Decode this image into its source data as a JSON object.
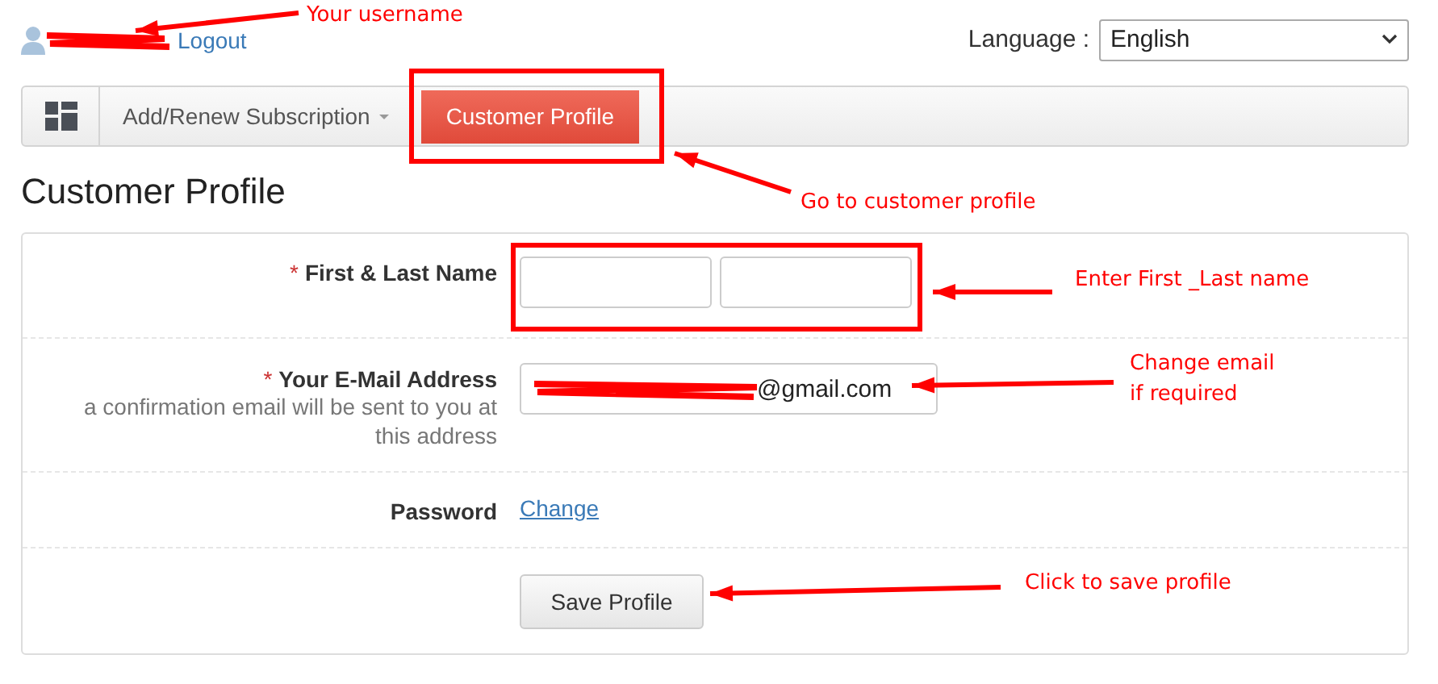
{
  "user_bar": {
    "logout": "Logout",
    "language_label": "Language :",
    "language": "English"
  },
  "nav": {
    "items": [
      {
        "label": "Add/Renew Subscription",
        "kind": "dropdown",
        "selected": false
      },
      {
        "label": "Customer Profile",
        "kind": "button",
        "selected": true
      }
    ]
  },
  "heading": "Customer Profile",
  "form": {
    "rows": [
      {
        "kind": "name",
        "label": "First & Last Name",
        "required_mark": "*"
      },
      {
        "kind": "email",
        "label": "Your E-Mail Address",
        "required_mark": "*",
        "hint": "a confirmation email will be sent to you at this address",
        "value": "@gmail.com"
      },
      {
        "kind": "link",
        "label": "Password",
        "link": "Change"
      },
      {
        "kind": "submit",
        "button": "Save Profile"
      }
    ]
  },
  "annotations": [
    {
      "lines": [
        "Your username"
      ]
    },
    {
      "lines": [
        "Go to customer profile"
      ]
    },
    {
      "lines": [
        "Enter First _Last name"
      ]
    },
    {
      "lines": [
        "Change email",
        "if required"
      ]
    },
    {
      "lines": [
        "Click to save profile"
      ]
    }
  ]
}
